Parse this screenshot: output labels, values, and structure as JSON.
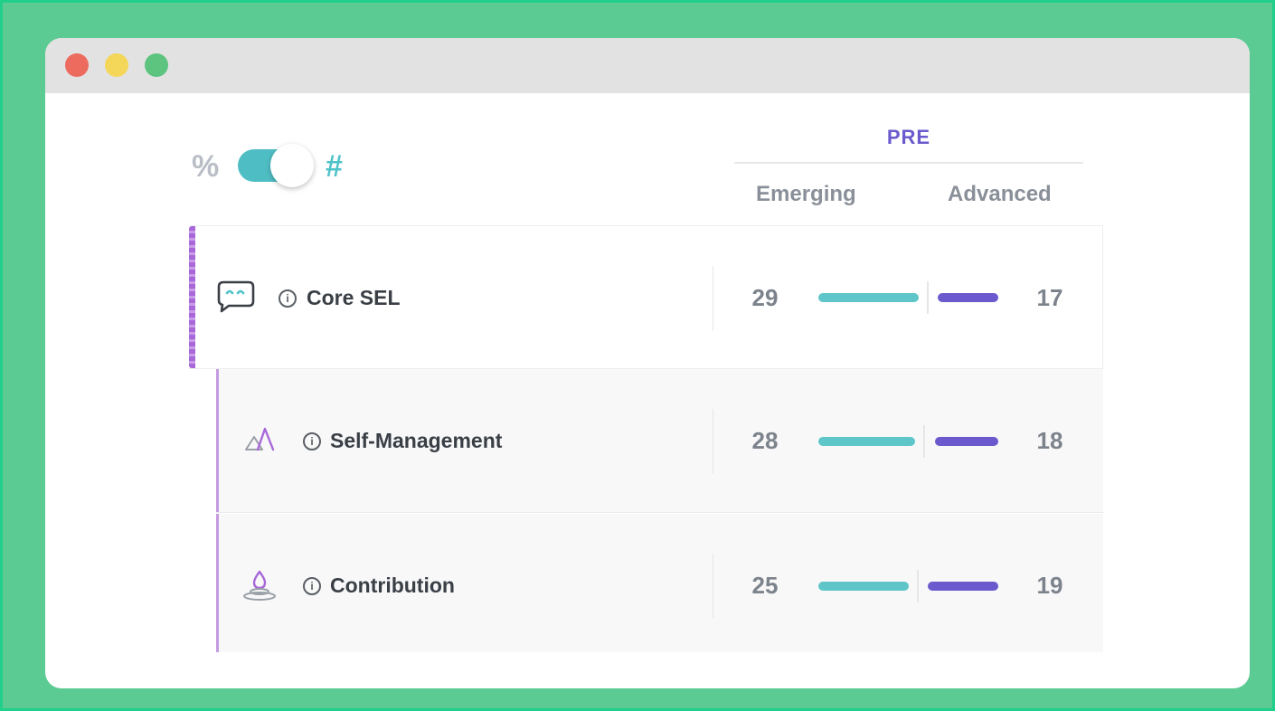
{
  "window": {
    "dots": [
      "close",
      "minimize",
      "maximize"
    ]
  },
  "toggle": {
    "left_symbol": "%",
    "right_symbol": "#",
    "state": "#"
  },
  "header": {
    "group": "PRE",
    "col_emerging": "Emerging",
    "col_advanced": "Advanced"
  },
  "colors": {
    "emerging": "#5ec6c8",
    "advanced": "#6a5acd",
    "accent": "#a868d8"
  },
  "rows": [
    {
      "icon": "speech-bubble-smile-icon",
      "label": "Core SEL",
      "emerging": 29,
      "advanced": 17
    },
    {
      "icon": "mountains-icon",
      "label": "Self-Management",
      "emerging": 28,
      "advanced": 18
    },
    {
      "icon": "droplet-ripple-icon",
      "label": "Contribution",
      "emerging": 25,
      "advanced": 19
    }
  ]
}
